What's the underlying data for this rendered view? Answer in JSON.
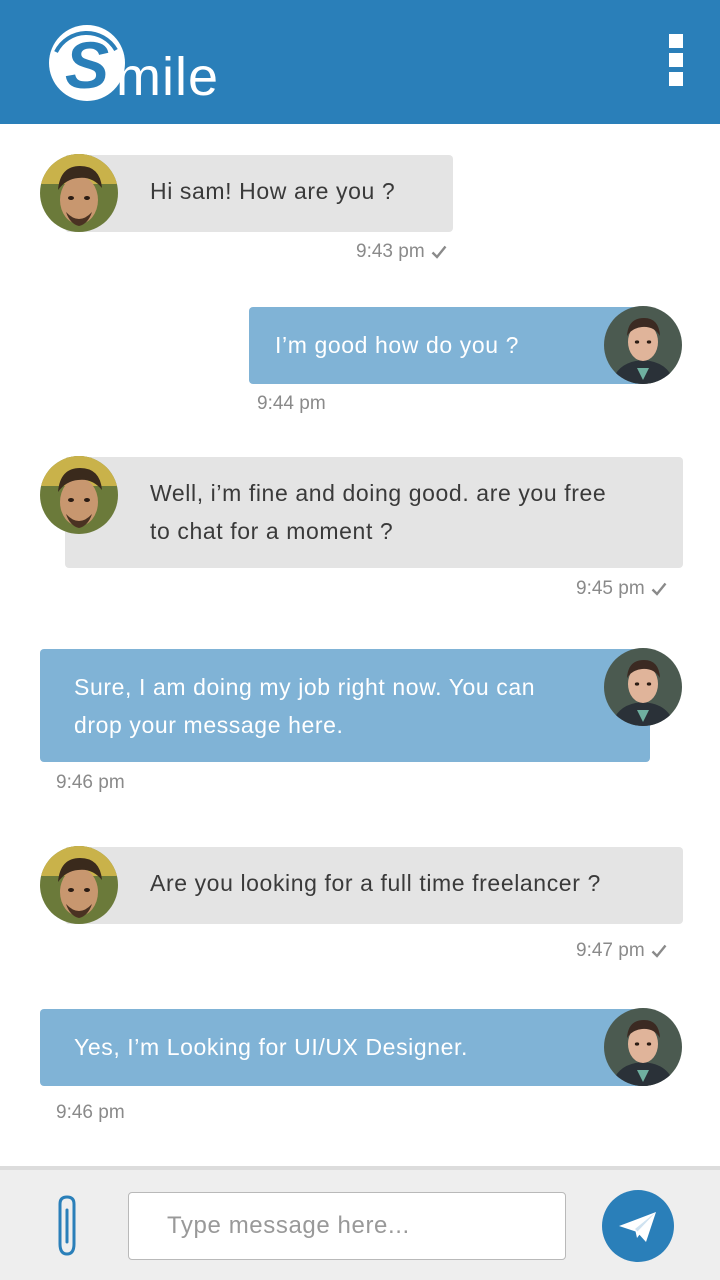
{
  "app": {
    "logo_letter": "S",
    "logo_rest": "mile",
    "brand_color": "#2a7fb9"
  },
  "header": {
    "menu_icon": "more-vertical-icon"
  },
  "messages": [
    {
      "direction": "incoming",
      "lines": [
        "Hi sam! How are you ?"
      ],
      "time": "9:43 pm",
      "status": "sent-check"
    },
    {
      "direction": "outgoing",
      "lines": [
        "I’m good how do you ?"
      ],
      "time": "9:44 pm"
    },
    {
      "direction": "incoming",
      "lines": [
        "Well, i’m fine and doing good. are you free",
        "to chat for a moment ?"
      ],
      "time": "9:45 pm",
      "status": "sent-check"
    },
    {
      "direction": "outgoing",
      "lines": [
        "Sure, I am doing my job right now. You can",
        "drop your message here."
      ],
      "time": "9:46 pm"
    },
    {
      "direction": "incoming",
      "lines": [
        "Are you looking for a full time freelancer ?"
      ],
      "time": "9:47 pm",
      "status": "sent-check"
    },
    {
      "direction": "outgoing",
      "lines": [
        "Yes, I’m Looking for UI/UX Designer."
      ],
      "time": "9:46 pm"
    }
  ],
  "composer": {
    "placeholder": "Type message here...",
    "value": "",
    "attach_icon": "paperclip-icon",
    "send_icon": "paper-plane-icon"
  },
  "colors": {
    "incoming_bubble": "#e4e4e4",
    "outgoing_bubble": "#80b3d6"
  }
}
